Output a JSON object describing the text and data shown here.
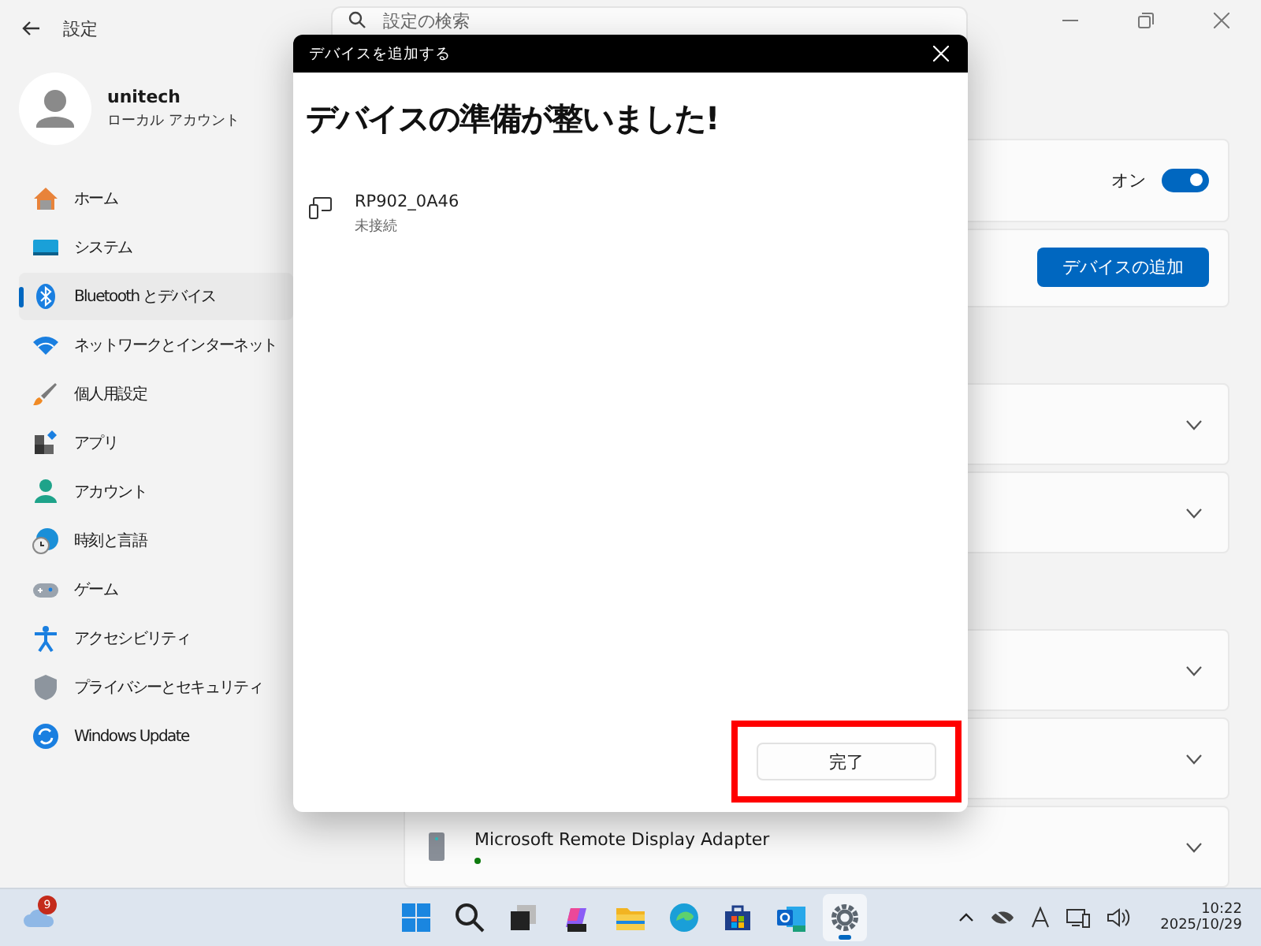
{
  "window": {
    "title": "設定",
    "search": {
      "placeholder": "設定の検索"
    }
  },
  "profile": {
    "name": "unitech",
    "account": "ローカル アカウント"
  },
  "sidebar": {
    "items": [
      {
        "label": "ホーム",
        "kind": "home",
        "selected": false
      },
      {
        "label": "システム",
        "kind": "system",
        "selected": false
      },
      {
        "label": "Bluetooth とデバイス",
        "kind": "bluetooth",
        "selected": true
      },
      {
        "label": "ネットワークとインターネット",
        "kind": "network",
        "selected": false
      },
      {
        "label": "個人用設定",
        "kind": "personalize",
        "selected": false
      },
      {
        "label": "アプリ",
        "kind": "apps",
        "selected": false
      },
      {
        "label": "アカウント",
        "kind": "account",
        "selected": false
      },
      {
        "label": "時刻と言語",
        "kind": "time",
        "selected": false
      },
      {
        "label": "ゲーム",
        "kind": "gaming",
        "selected": false
      },
      {
        "label": "アクセシビリティ",
        "kind": "accessibility",
        "selected": false
      },
      {
        "label": "プライバシーとセキュリティ",
        "kind": "privacy",
        "selected": false
      },
      {
        "label": "Windows Update",
        "kind": "update",
        "selected": false
      }
    ]
  },
  "bluetooth_card": {
    "state_label": "オン",
    "on": true
  },
  "add_device_button": "デバイスの追加",
  "device_groups": [
    {
      "cards": [
        {
          "expanded": false
        },
        {
          "expanded": false
        }
      ]
    },
    {
      "cards": [
        {
          "expanded": false
        },
        {
          "expanded": false
        },
        {
          "name": "Microsoft Remote Display Adapter",
          "color": "#0f7b0f",
          "expanded": false
        }
      ]
    }
  ],
  "dialog": {
    "title": "デバイスを追加する",
    "heading": "デバイスの準備が整いました!",
    "devices": [
      {
        "name": "RP902_0A46",
        "status": "未接続"
      }
    ],
    "done_button": "完了",
    "highlighted": true
  },
  "taskbar": {
    "weather_badge": "9",
    "apps": [
      {
        "kind": "start",
        "active": false
      },
      {
        "kind": "search",
        "active": false
      },
      {
        "kind": "taskview",
        "active": false
      },
      {
        "kind": "copilot",
        "active": false
      },
      {
        "kind": "explorer",
        "active": false
      },
      {
        "kind": "edge",
        "active": false
      },
      {
        "kind": "store",
        "active": false
      },
      {
        "kind": "outlook",
        "active": false
      },
      {
        "kind": "settings",
        "active": true
      }
    ],
    "time": "10:22",
    "date": "2025/10/29"
  }
}
